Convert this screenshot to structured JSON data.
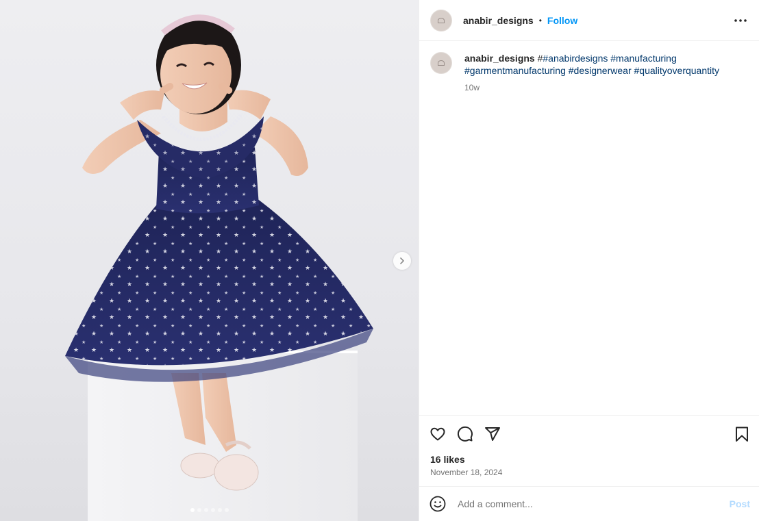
{
  "post": {
    "username": "anabir_designs",
    "separator": "•",
    "follow_label": "Follow",
    "more_icon": "more-horizontal-icon"
  },
  "caption": {
    "username": "anabir_designs",
    "prefix": "#",
    "hashtags": [
      "#anabirdesigns",
      "#manufacturing",
      "#garmentmanufacturing",
      "#designerwear",
      "#qualityoverquantity"
    ],
    "time_ago": "10w"
  },
  "media": {
    "slide_count": 6,
    "active_slide": 1,
    "next_icon": "chevron-right-icon"
  },
  "actions": {
    "like_icon": "heart-icon",
    "comment_icon": "comment-icon",
    "share_icon": "send-icon",
    "save_icon": "bookmark-icon"
  },
  "stats": {
    "likes": "16 likes",
    "date": "November 18, 2024"
  },
  "comment": {
    "placeholder": "Add a comment...",
    "post_label": "Post",
    "emoji_icon": "emoji-icon"
  },
  "colors": {
    "link": "#0095f6",
    "hashtag": "#00376b",
    "post_disabled": "#b3dbff",
    "muted": "#737373",
    "dress": "#23285e"
  }
}
